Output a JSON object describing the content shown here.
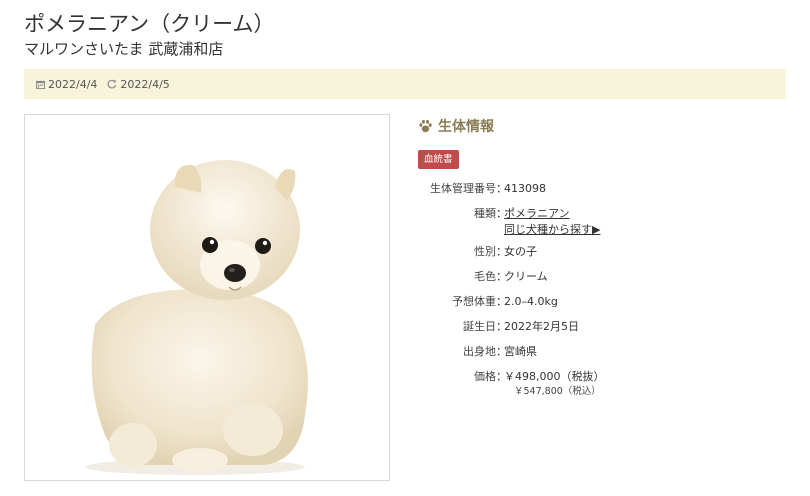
{
  "header": {
    "title": "ポメラニアン（クリーム）",
    "subtitle": "マルワンさいたま 武蔵浦和店"
  },
  "dates": {
    "published": "2022/4/4",
    "updated": "2022/4/5",
    "published_icon": "calendar-icon",
    "updated_icon": "refresh-icon"
  },
  "photo": {
    "alt": "cream pomeranian puppy photo"
  },
  "info": {
    "section_title": "生体情報",
    "section_icon": "paw-icon",
    "badge": "血統書",
    "rows": [
      {
        "label": "生体管理番号",
        "value": "413098"
      },
      {
        "label": "種類",
        "value": "ポメラニアン",
        "link2": "同じ犬種から探す▶"
      },
      {
        "label": "性別",
        "value": "女の子"
      },
      {
        "label": "毛色",
        "value": "クリーム"
      },
      {
        "label": "予想体重",
        "value": "2.0–4.0kg"
      },
      {
        "label": "誕生日",
        "value": "2022年2月5日"
      },
      {
        "label": "出身地",
        "value": "宮崎県"
      },
      {
        "label": "価格",
        "value": "￥498,000（税抜）",
        "sub": "￥547,800（税込）"
      }
    ],
    "separator": "："
  },
  "colors": {
    "accent": "#8a7d55",
    "badge": "#c14a4a",
    "datebar": "#f8f4dc"
  }
}
